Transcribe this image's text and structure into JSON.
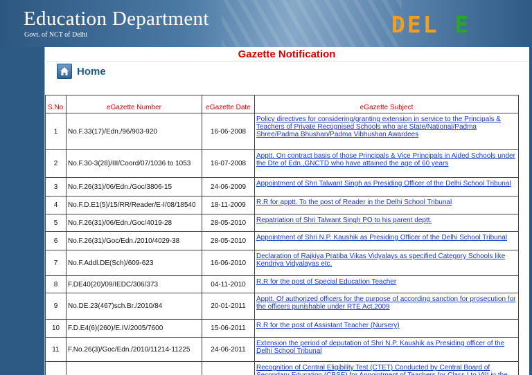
{
  "header": {
    "title": "Education Department",
    "subtitle": "Govt. of NCT of Delhi",
    "logo_part_a": "DEL",
    "logo_part_b": "E",
    "logo_colors": {
      "part_a": "#f0a020",
      "part_b": "#2aa52c"
    }
  },
  "page": {
    "title": "Gazette Notification",
    "title_color": "#cc0000",
    "home_label": "Home",
    "home_icon": "home-icon"
  },
  "table": {
    "headers": [
      "S.No",
      "eGazette Number",
      "eGazette Date",
      "eGazette Subject"
    ],
    "rows": [
      {
        "sno": "1",
        "number": "No.F.33(17)/Edn./96/903-920",
        "date": "16-06-2008",
        "subject": "Policy directives for considering/granting extension in service to the Principals & Teachers of Private Recognised Schools who are State/National/Padma Shree/Padma Bhushan/Padma Vibhushan Awardees"
      },
      {
        "sno": "2",
        "number": "No.F.30-3(28)/III/Coord/07/1036 to 1053",
        "date": "16-07-2008",
        "subject": "Apptt. On contract basis of those Principals & Vice Principals in Aided Schools under the Dte of Edn.,GNCTD who have attained the age of 60 years"
      },
      {
        "sno": "3",
        "number": "No.F.26(31)/06/Edn./Goc/3806-15",
        "date": "24-06-2009",
        "subject": "Appointment of Shri Talwant Singh as Presiding Officer of the Delhi School Tribunal"
      },
      {
        "sno": "4",
        "number": "No.F.D.E1(5)/15/RR/Reader/E-I/08/18540",
        "date": "18-11-2009",
        "subject": "R.R for apptt. To the post of Reader in the Delhi School Tribunal"
      },
      {
        "sno": "5",
        "number": "No.F.26(31)/06/Edn./Goc/4019-28",
        "date": "28-05-2010",
        "subject": "Repatriation of Shri Talwant Singh PO to his parent deptt."
      },
      {
        "sno": "6",
        "number": "No.F.26(31)/Goc/Edn./2010/4029-38",
        "date": "28-05-2010",
        "subject": "Appointment of Shri N.P. Kaushik as Presiding Officer of the Delhi School Tribunal"
      },
      {
        "sno": "7",
        "number": "No.F.Addl.DE(Sch)/609-623",
        "date": "16-06-2010",
        "subject": "Declaration of Rajkiya Pratiba Vikas Vidyalays as specified Category Schools like Kendriya Vidyalayas etc."
      },
      {
        "sno": "8",
        "number": "F.DE40(20)/09/IEDC/306/373",
        "date": "04-11-2010",
        "subject": "R.R for the post of Special Education Teacher"
      },
      {
        "sno": "9",
        "number": "No.DE.23(467)sch.Br./2010/84",
        "date": "20-01-2011",
        "subject": "Apptt. Of authorized officers for the purpose of according sanction for prosecution for the officers punishable under RTE Act,2009"
      },
      {
        "sno": "10",
        "number": "F.D.E4(6)(260)/E.IV/2005/7600",
        "date": "15-06-2011",
        "subject": "R.R for the post of Assistant Teacher (Nursery)"
      },
      {
        "sno": "11",
        "number": "F.No.26(3)/Goc/Edn./2010/11214-11225",
        "date": "24-06-2011",
        "subject": "Extension the period of deputation of Shri N.P. Kaushik as Presiding officer of the Delhi School Tribunal"
      },
      {
        "sno": "",
        "number": "",
        "date": "",
        "subject": "Recognition of Central Eligibility Test (CTET) Conducted by Central Board of Secondary Education (CBSE) for Appointment of Teachers for Class I to VIII in the"
      }
    ]
  }
}
